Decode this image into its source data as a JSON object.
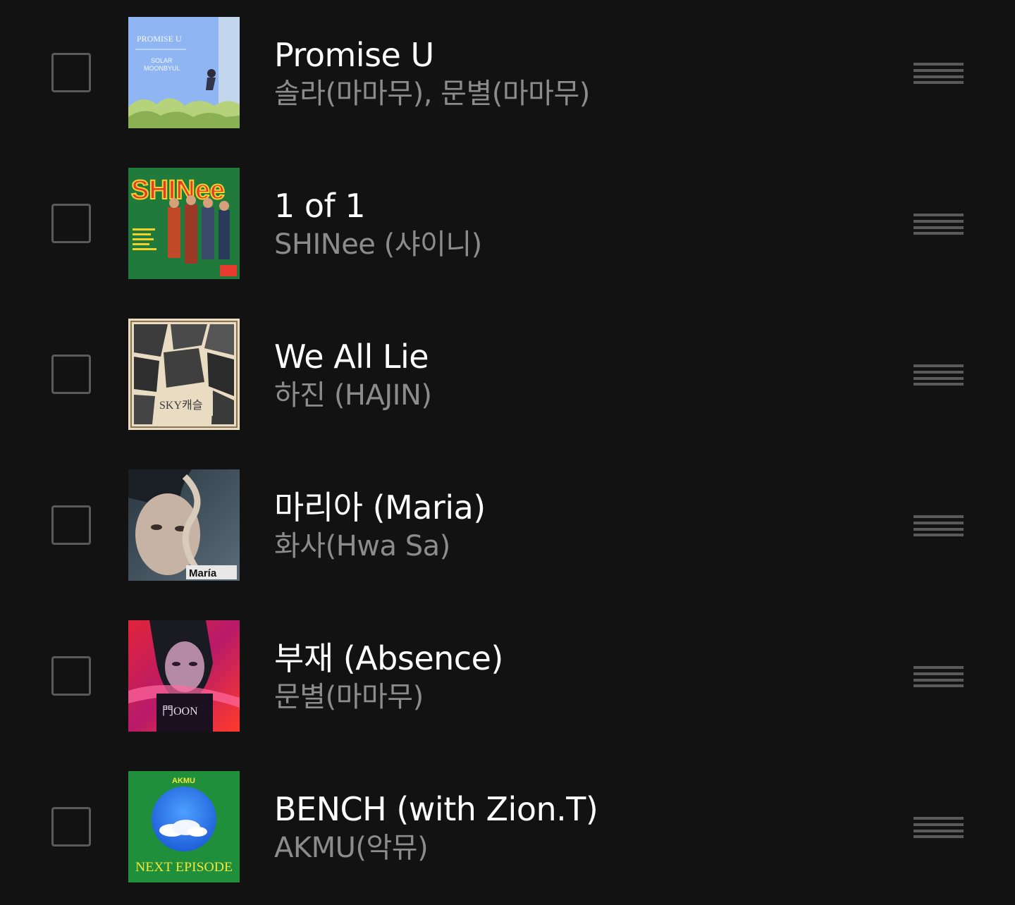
{
  "tracks": [
    {
      "title": "Promise U",
      "artist": "솔라(마마무), 문별(마마무)",
      "cover": {
        "label": "PROMISE U",
        "sublabel1": "SOLAR",
        "sublabel2": "MOONBYUL"
      }
    },
    {
      "title": "1 of 1",
      "artist": "SHINee (샤이니)",
      "cover": {
        "label": "SHINee"
      }
    },
    {
      "title": "We All Lie",
      "artist": "하진 (HAJIN)",
      "cover": {
        "label": "SKY캐슬"
      }
    },
    {
      "title": "마리아 (Maria)",
      "artist": "화사(Hwa Sa)",
      "cover": {
        "label": "María"
      }
    },
    {
      "title": "부재 (Absence)",
      "artist": "문별(마마무)",
      "cover": {
        "label": "門OON"
      }
    },
    {
      "title": "BENCH (with Zion.T)",
      "artist": "AKMU(악뮤)",
      "cover": {
        "label": "AKMU",
        "sublabel1": "NEXT EPISODE"
      }
    }
  ],
  "colors": {
    "background": "#121212",
    "title": "#ffffff",
    "artist": "#8c8c8c",
    "control": "#5a5a5a"
  },
  "icons": {
    "checkbox": "checkbox-icon",
    "drag_handle": "drag-handle-icon"
  }
}
